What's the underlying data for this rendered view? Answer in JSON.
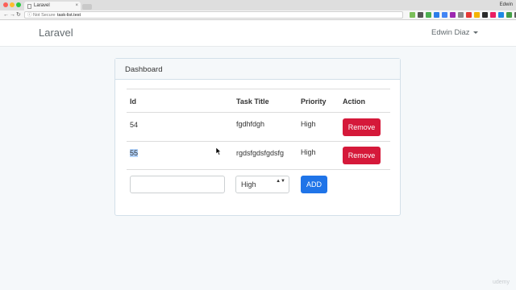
{
  "browser": {
    "tab_title": "Laravel",
    "tab_close": "×",
    "profile": "Edwin",
    "security_label": "Not Secure",
    "url": "task-list.test",
    "nav_back": "←",
    "nav_forward": "→",
    "nav_reload": "↻",
    "info_icon": "ⓘ",
    "menu_icon": "⋮",
    "extension_colors": [
      "#7bbf5a",
      "#555555",
      "#4caf50",
      "#2b7de9",
      "#4285f4",
      "#9c27b0",
      "#8a8a8a",
      "#e53935",
      "#f4b400",
      "#2b2b2b",
      "#e91e63",
      "#1e88e5",
      "#43a047",
      "#616161",
      "#ff9800"
    ]
  },
  "navbar": {
    "brand": "Laravel",
    "user_name": "Edwin Diaz"
  },
  "panel": {
    "heading": "Dashboard"
  },
  "table": {
    "headers": [
      "Id",
      "Task Title",
      "Priority",
      "Action"
    ],
    "rows": [
      {
        "id": "54",
        "title": "fgdhfdgh",
        "priority": "High",
        "action": "Remove"
      },
      {
        "id": "55",
        "title": "rgdsfgdsfgdsfg",
        "priority": "High",
        "action": "Remove"
      }
    ]
  },
  "form": {
    "task_value": "",
    "task_placeholder": "",
    "priority_selected": "High",
    "add_label": "ADD",
    "select_arrows": "▲▼"
  },
  "watermark": "udemy",
  "colors": {
    "remove_button": "#d5193a",
    "add_button": "#1f74e8",
    "selection_highlight": "#b3d4fd"
  }
}
